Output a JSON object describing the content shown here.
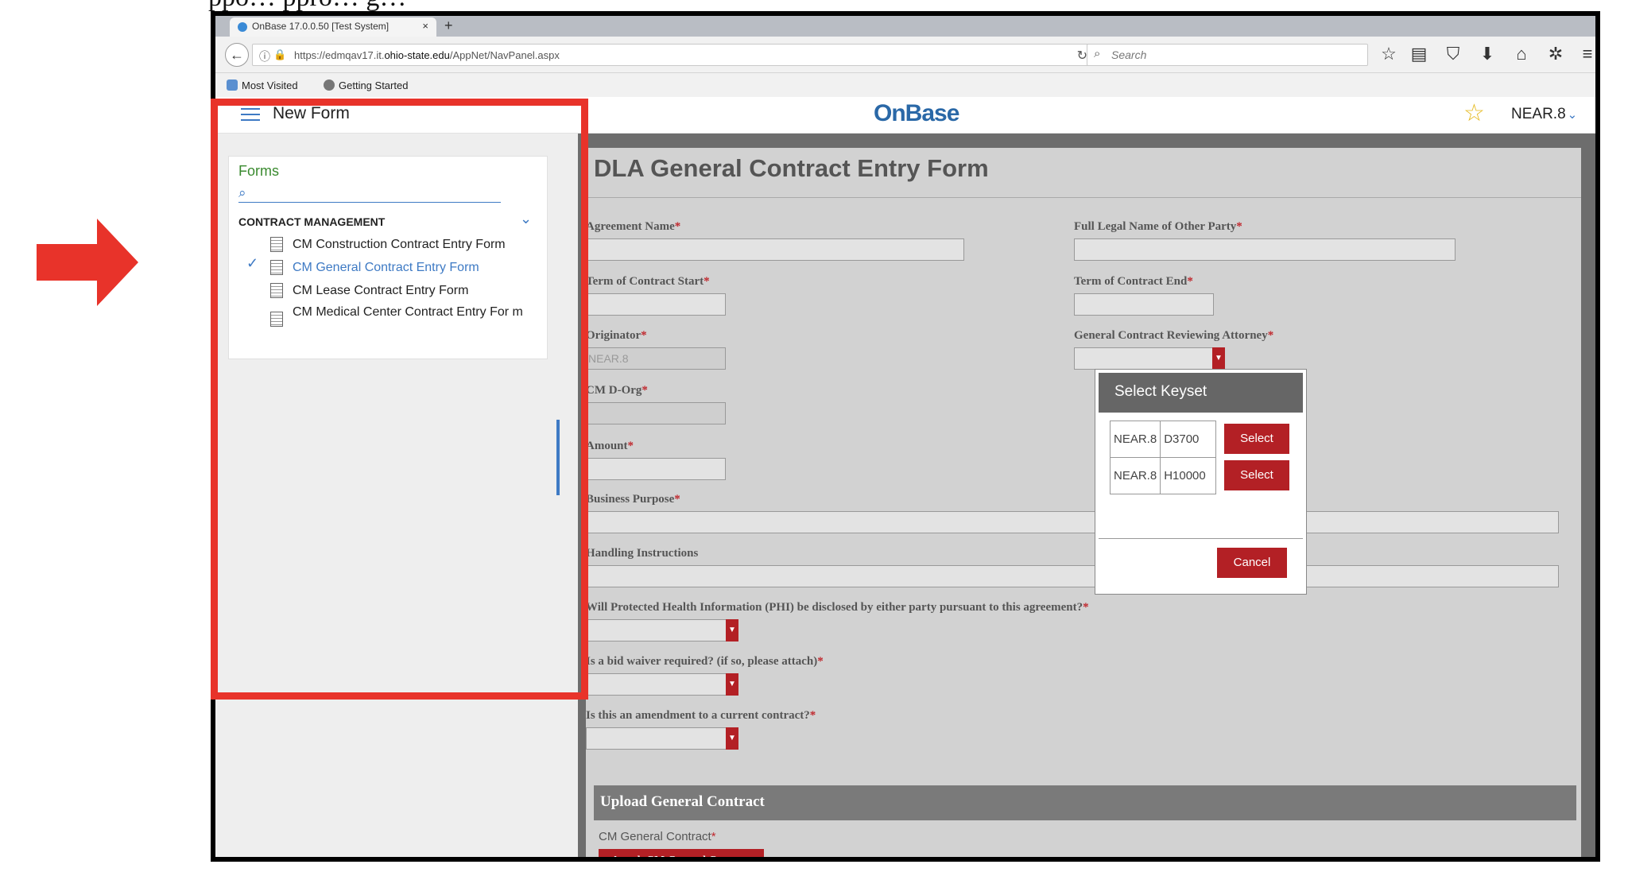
{
  "heading_fragment": "ppo… ppro… g…",
  "browser": {
    "tab_title": "OnBase 17.0.0.50 [Test System]",
    "url_prefix": "https://edmqav17.it.",
    "url_host": "ohio-state.edu",
    "url_path": "/AppNet/NavPanel.aspx",
    "search_placeholder": "Search",
    "bookmarks": [
      "Most Visited",
      "Getting Started"
    ]
  },
  "app": {
    "menu_title": "New Form",
    "logo": "OnBase",
    "user": "NEAR.8"
  },
  "sidebar": {
    "forms_label": "Forms",
    "section": "CONTRACT MANAGEMENT",
    "items": [
      {
        "label": "CM Construction Contract Entry Form",
        "active": false
      },
      {
        "label": "CM General Contract Entry Form",
        "active": true
      },
      {
        "label": "CM Lease Contract Entry Form",
        "active": false
      },
      {
        "label": "CM Medical Center Contract Entry For m",
        "active": false
      }
    ]
  },
  "form": {
    "title": "DLA General Contract Entry Form",
    "fields": {
      "agreement_name": "Agreement Name",
      "full_legal_name": "Full Legal Name of Other Party",
      "term_start": "Term of Contract Start",
      "term_end": "Term of Contract End",
      "originator": "Originator",
      "originator_value": "NEAR.8",
      "reviewing_attorney": "General Contract Reviewing Attorney",
      "cm_dorg": "CM D-Org",
      "amount": "Amount",
      "business_purpose": "Business Purpose",
      "handling_instructions": "Handling Instructions",
      "phi_question": "Will Protected Health Information (PHI) be disclosed by either party pursuant to this agreement?",
      "bid_waiver": "Is a bid waiver required? (if so, please attach)",
      "amendment": "Is this an amendment to a current contract?"
    },
    "required_mark": "*",
    "upload_section": "Upload General Contract",
    "upload_field": "CM General Contract",
    "attach_button": "Attach CM General Contract"
  },
  "modal": {
    "title": "Select Keyset",
    "rows": [
      {
        "user": "NEAR.8",
        "keyset": "D3700",
        "button": "Select"
      },
      {
        "user": "NEAR.8",
        "keyset": "H10000",
        "button": "Select"
      }
    ],
    "cancel": "Cancel"
  },
  "colors": {
    "highlight": "#e8332a",
    "arrow": "#e8332a",
    "button_red": "#b32025",
    "link_blue": "#3e7ac4"
  }
}
